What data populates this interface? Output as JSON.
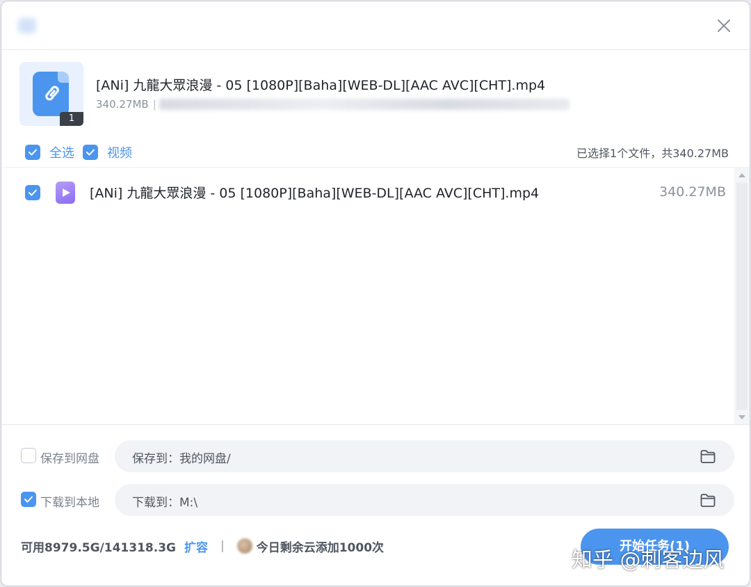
{
  "window": {
    "title": ""
  },
  "task": {
    "name": "[ANi] 九龍大眾浪漫 - 05 [1080P][Baha][WEB-DL][AAC AVC][CHT].mp4",
    "size": "340.27MB",
    "separator": "|",
    "file_count": "1",
    "icon": "link-file-icon"
  },
  "filters": {
    "select_all": "全选",
    "video": "视频",
    "summary": "已选择1个文件，共340.27MB"
  },
  "files": [
    {
      "name": "[ANi] 九龍大眾浪漫 - 05 [1080P][Baha][WEB-DL][AAC AVC][CHT].mp4",
      "size": "340.27MB",
      "checked": true,
      "icon": "video-file-icon"
    }
  ],
  "save_options": {
    "cloud": {
      "label": "保存到网盘",
      "path": "保存到：我的网盘/",
      "checked": false
    },
    "local": {
      "label": "下载到本地",
      "path": "下载到：M:\\",
      "checked": true
    }
  },
  "status": {
    "quota": "可用8979.5G/141318.3G",
    "expand_label": "扩容",
    "divider": "|",
    "daily_quota": "今日剩余云添加1000次"
  },
  "start_button": {
    "label": "开始任务(1)"
  },
  "watermark": "知乎 @刺客边风",
  "colors": {
    "accent": "#4b95ee",
    "video_icon": "#8a6df2",
    "text": "#1f2329",
    "muted": "#8a919c"
  }
}
